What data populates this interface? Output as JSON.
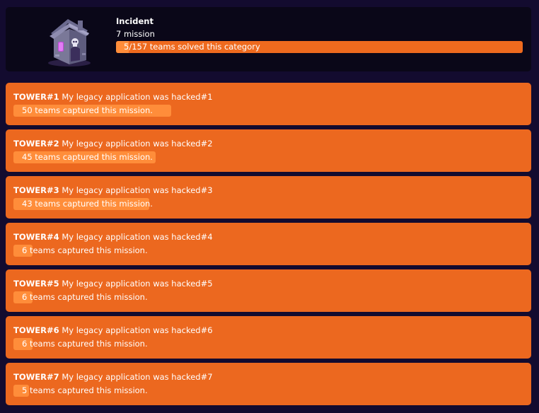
{
  "category": {
    "title": "Incident",
    "mission_count": "7 mission",
    "progress_text": "5/157 teams solved this category",
    "progress_fraction": 0.032,
    "icon": "haunted-house-icon"
  },
  "missions": [
    {
      "tag": "TOWER#1",
      "name": "My legacy application was hacked#1",
      "captured_text": "50 teams captured this mission.",
      "progress_fraction": 0.318
    },
    {
      "tag": "TOWER#2",
      "name": "My legacy application was hacked#2",
      "captured_text": "45 teams captured this mission.",
      "progress_fraction": 0.287
    },
    {
      "tag": "TOWER#3",
      "name": "My legacy application was hacked#3",
      "captured_text": "43 teams captured this mission.",
      "progress_fraction": 0.274
    },
    {
      "tag": "TOWER#4",
      "name": "My legacy application was hacked#4",
      "captured_text": "6 teams captured this mission.",
      "progress_fraction": 0.038
    },
    {
      "tag": "TOWER#5",
      "name": "My legacy application was hacked#5",
      "captured_text": "6 teams captured this mission.",
      "progress_fraction": 0.038
    },
    {
      "tag": "TOWER#6",
      "name": "My legacy application was hacked#6",
      "captured_text": "6 teams captured this mission.",
      "progress_fraction": 0.038
    },
    {
      "tag": "TOWER#7",
      "name": "My legacy application was hacked#7",
      "captured_text": "5 teams captured this mission.",
      "progress_fraction": 0.032
    }
  ]
}
